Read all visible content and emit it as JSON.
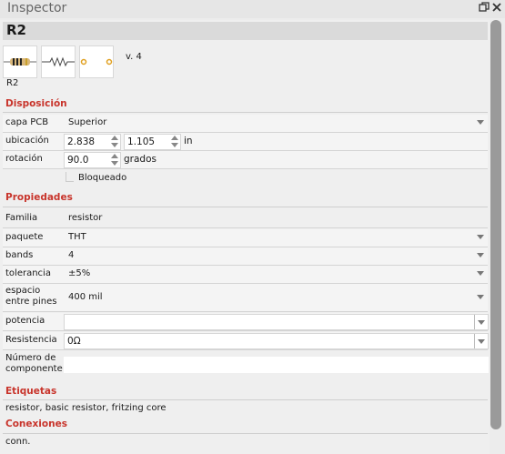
{
  "window": {
    "title": "Inspector"
  },
  "part": {
    "name": "R2",
    "version": "v. 4",
    "label": "R2"
  },
  "sections": {
    "placement": "Disposición",
    "properties": "Propiedades",
    "tags": "Etiquetas",
    "connections": "Conexiones"
  },
  "placement": {
    "pcb_layer": {
      "label": "capa PCB",
      "value": "Superior"
    },
    "location": {
      "label": "ubicación",
      "x": "2.838",
      "y": "1.105",
      "unit": "in"
    },
    "rotation": {
      "label": "rotación",
      "value": "90.0",
      "unit": "grados"
    },
    "locked": {
      "label": "Bloqueado",
      "checked": false
    }
  },
  "properties": {
    "family": {
      "label": "Familia",
      "value": "resistor"
    },
    "package": {
      "label": "paquete",
      "value": "THT"
    },
    "bands": {
      "label": "bands",
      "value": "4"
    },
    "tolerance": {
      "label": "tolerancia",
      "value": "±5%"
    },
    "pin_spacing": {
      "label_line1": "espacio",
      "label_line2": "entre pines",
      "value": "400 mil"
    },
    "power": {
      "label": "potencia",
      "value": ""
    },
    "resistance": {
      "label": "Resistencia",
      "value": "0Ω"
    },
    "part_number": {
      "label_line1": "Número de",
      "label_line2": "componente",
      "value": ""
    }
  },
  "tags": {
    "text": "resistor, basic resistor, fritzing core"
  },
  "connections": {
    "text": "conn."
  },
  "icons": [
    "restore-icon",
    "close-icon",
    "resistor-breadboard-icon",
    "resistor-schematic-icon",
    "resistor-pcb-icon",
    "chevron-down-icon",
    "spin-up-icon",
    "spin-down-icon"
  ],
  "colors": {
    "section_header": "#c8342b",
    "scrollbar": "#9a9a9a"
  }
}
